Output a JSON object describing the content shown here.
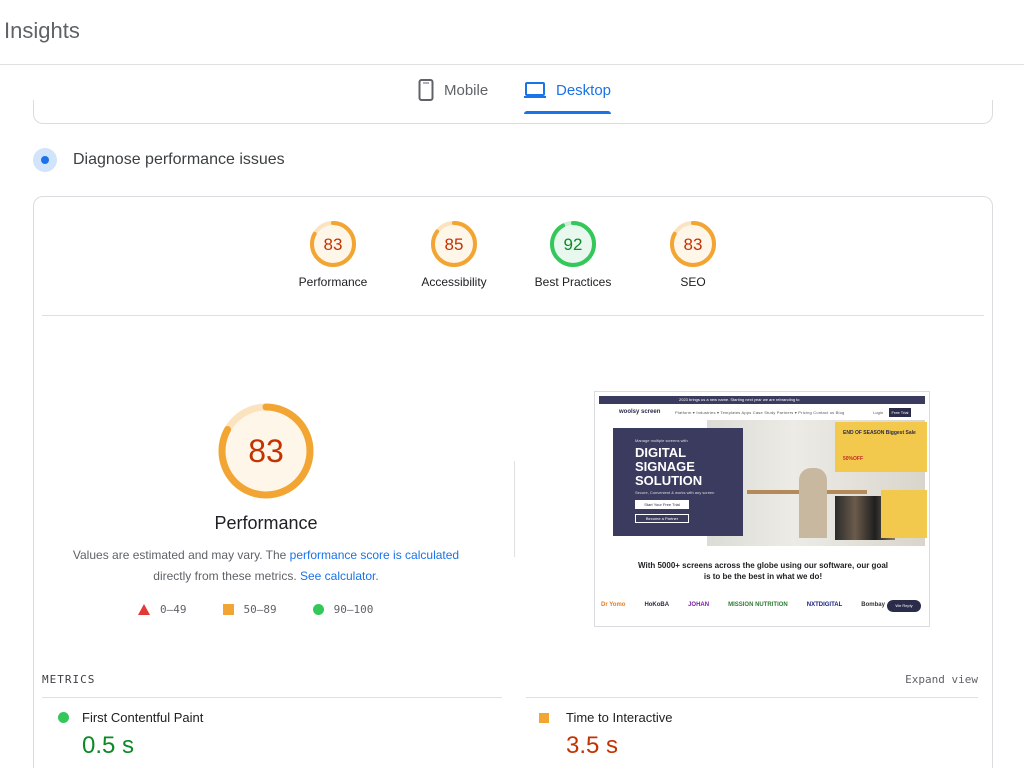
{
  "app": {
    "title": "Insights"
  },
  "tabs": [
    {
      "label": "Mobile",
      "icon": "smartphone-icon",
      "selected": false
    },
    {
      "label": "Desktop",
      "icon": "laptop-icon",
      "selected": true
    }
  ],
  "section": {
    "title": "Diagnose performance issues",
    "icon": "diagnose-icon"
  },
  "colors": {
    "accent": "#1a73e8",
    "average": "#f2a532",
    "good": "#34c759",
    "poor": "#e53935",
    "average_text": "#c33300",
    "good_text": "#0c8a26"
  },
  "scores": [
    {
      "label": "Performance",
      "value": "83",
      "fraction": 0.83,
      "status": "average"
    },
    {
      "label": "Accessibility",
      "value": "85",
      "fraction": 0.85,
      "status": "average"
    },
    {
      "label": "Best Practices",
      "value": "92",
      "fraction": 0.92,
      "status": "good"
    },
    {
      "label": "SEO",
      "value": "83",
      "fraction": 0.83,
      "status": "average"
    }
  ],
  "performance": {
    "score": "83",
    "fraction": 0.83,
    "title": "Performance",
    "desc_1": "Values are estimated and may vary. The ",
    "link_1": "performance score is calculated",
    "desc_2": "directly from these metrics. ",
    "link_2": "See calculator",
    "desc_3": "."
  },
  "legend": [
    {
      "range": "0–49",
      "shape": "triangle"
    },
    {
      "range": "50–89",
      "shape": "square"
    },
    {
      "range": "90–100",
      "shape": "circle"
    }
  ],
  "screenshot": {
    "top_strip": "2023 brings us a new name. Starting next year we are rebranding to",
    "logo": "woolsy screen",
    "nav": "Platform ▾  Industries ▾  Templates  Apps  Case Study  Partners ▾  Pricing  Contact us  Blog",
    "nav_login": "Login",
    "nav_trial": "Free Trial",
    "hero_small": "Manage multiple screens with",
    "hero_big": "DIGITAL SIGNAGE SOLUTION",
    "hero_sub": "Secure, Convenient & works with any screen",
    "hero_btn1": "Start Your Free Trial",
    "hero_btn2": "Become a Partner",
    "promo_title": "END OF SEASON Biggest Sale",
    "promo_off": "50%OFF",
    "caption": "With 5000+ screens across the globe using our software, our goal is to be the best in what we do!",
    "logos": [
      "Dr Yomo",
      "HoKoBA",
      "JOHAN",
      "MISSION NUTRITION",
      "NXTDIGITAL",
      "Bombay"
    ],
    "chat": "We Reply"
  },
  "metrics": {
    "title": "METRICS",
    "expand": "Expand view",
    "items": [
      {
        "name": "First Contentful Paint",
        "value": "0.5 s",
        "status": "good"
      },
      {
        "name": "Time to Interactive",
        "value": "3.5 s",
        "status": "average"
      }
    ]
  }
}
